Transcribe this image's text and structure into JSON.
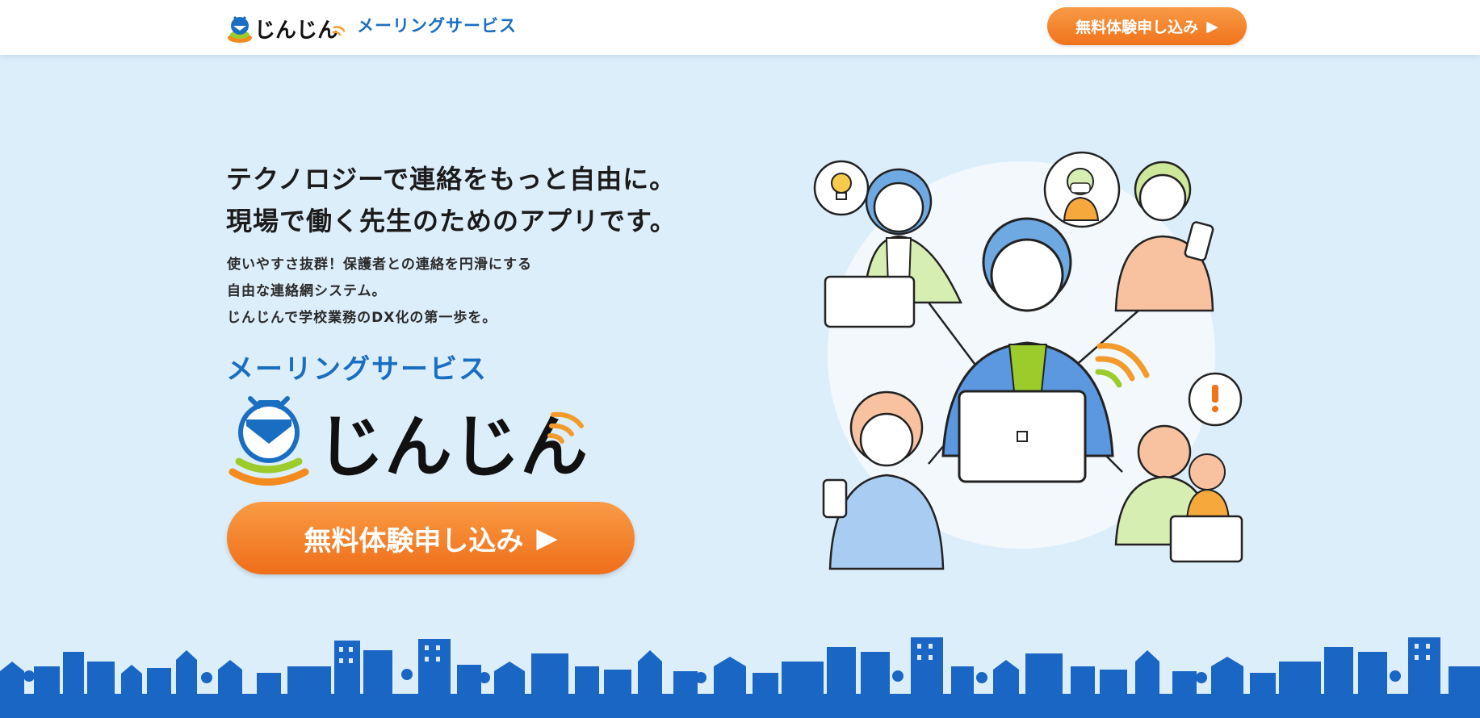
{
  "header": {
    "logo_alt": "じんじん",
    "service_label": "メーリングサービス",
    "cta_label": "無料体験申し込み",
    "cta_arrow": "▶"
  },
  "hero": {
    "headline_lines": [
      "テクノロジーで連絡をもっと自由に。",
      "現場で働く先生のためのアプリです。"
    ],
    "description_lines": [
      "使いやすさ抜群！保護者との連絡を円滑にする",
      "自由な連絡網システム。",
      "じんじんで学校業務のDX化の第一歩を。"
    ],
    "service_name": "メーリングサービス",
    "logo_text": "じんじん",
    "cta_label": "無料体験申し込み",
    "cta_arrow": "▶"
  },
  "colors": {
    "background": "#ddeefb",
    "brand_blue": "#1a6ec2",
    "cta_orange": "#f37f25",
    "skyline_blue": "#1a66c4",
    "signal_orange": "#f39b2a",
    "signal_green": "#9ccc2b"
  },
  "icons": [
    "bell-mascot-icon",
    "signal-waves-icon",
    "play-arrow-icon",
    "lightbulb-icon",
    "exclamation-icon"
  ]
}
